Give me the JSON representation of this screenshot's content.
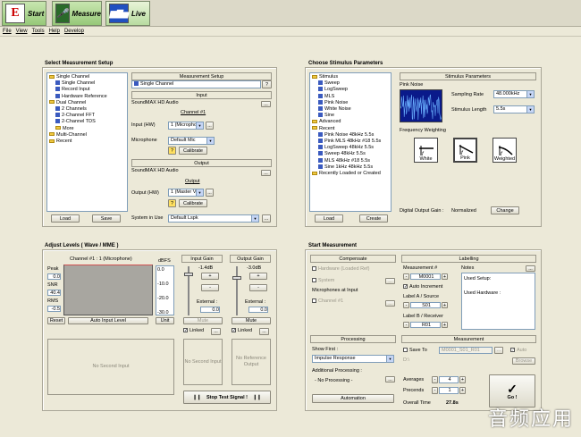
{
  "toolbar": {
    "start": "Start",
    "measure": "Measure",
    "live": "Live",
    "start_letter": "E"
  },
  "menu": [
    "File",
    "View",
    "Tools",
    "Help",
    "Develop"
  ],
  "setup": {
    "title": "Select Measurement Setup",
    "tree": [
      {
        "t": "Single Channel",
        "k": "folder",
        "i": 0
      },
      {
        "t": "Single Channel",
        "k": "item",
        "i": 1
      },
      {
        "t": "Record Input",
        "k": "item",
        "i": 1
      },
      {
        "t": "Hardware Reference",
        "k": "item",
        "i": 1
      },
      {
        "t": "Dual Channel",
        "k": "folder",
        "i": 0
      },
      {
        "t": "2 Channels",
        "k": "item",
        "i": 1
      },
      {
        "t": "2-Channel FFT",
        "k": "item",
        "i": 1
      },
      {
        "t": "2-Channel TDS",
        "k": "item",
        "i": 1
      },
      {
        "t": "More",
        "k": "folder",
        "i": 1
      },
      {
        "t": "Multi-Channel",
        "k": "folder",
        "i": 0
      },
      {
        "t": "Recent",
        "k": "folder",
        "i": 0
      }
    ],
    "load": "Load",
    "save": "Save",
    "ms_header": "Measurement Setup",
    "ms_value": "Single Channel",
    "ms_help": "?",
    "input_header": "Input",
    "input_device": "SoundMAX HD Audio",
    "channel": "Channel #1",
    "input_hw_label": "Input (HW)",
    "input_hw_value": "1 (Micropho",
    "mic_label": "Microphone",
    "mic_value": "Default Mic",
    "calibrate": "Calibrate",
    "help": "?",
    "output_header": "Output",
    "output_device": "SoundMAX HD Audio",
    "output_label": "Output",
    "output_hw_label": "Output (HW)",
    "output_hw_value": "1 (Master Vo",
    "system_label": "System in Use",
    "system_value": "Default Lspk",
    "more": "..."
  },
  "stimulus": {
    "title": "Choose Stimulus Parameters",
    "tree": [
      {
        "t": "Stimulus",
        "k": "folder",
        "i": 0
      },
      {
        "t": "Sweep",
        "k": "item",
        "i": 1
      },
      {
        "t": "LogSweep",
        "k": "item",
        "i": 1
      },
      {
        "t": "MLS",
        "k": "item",
        "i": 1
      },
      {
        "t": "Pink Noise",
        "k": "item",
        "i": 1
      },
      {
        "t": "White Noise",
        "k": "item",
        "i": 1
      },
      {
        "t": "Sine",
        "k": "item",
        "i": 1
      },
      {
        "t": "Advanced",
        "k": "folder",
        "i": 0
      },
      {
        "t": "Recent",
        "k": "folder",
        "i": 0
      },
      {
        "t": "Pink Noise 48kHz 5.5s",
        "k": "item",
        "i": 1
      },
      {
        "t": "Pink MLS 48kHz #18 5.5s",
        "k": "item",
        "i": 1
      },
      {
        "t": "LogSweep 48kHz 5.5s",
        "k": "item",
        "i": 1
      },
      {
        "t": "Sweep 48kHz 5.5s",
        "k": "item",
        "i": 1
      },
      {
        "t": "MLS 48kHz #18 5.5s",
        "k": "item",
        "i": 1
      },
      {
        "t": "Sine 1kHz 48kHz 5.5s",
        "k": "item",
        "i": 1
      },
      {
        "t": "Recently Loaded or Created",
        "k": "folder",
        "i": 0
      }
    ],
    "load": "Load",
    "create": "Create",
    "params_header": "Stimulus Parameters",
    "signal_name": "Pink Noise",
    "rate_label": "Sampling Rate",
    "rate_value": "48.000kHz",
    "length_label": "Stimulus Length",
    "length_value": "5.5s",
    "weight_label": "Frequency Weighting",
    "white": "White",
    "pink": "Pink",
    "weighted": "Weighted",
    "gain_label": "Digital Output Gain :",
    "gain_value": "Normalized",
    "change": "Change"
  },
  "levels": {
    "title": "Adjust Levels ( Wave / MME )",
    "channel_label": "Channel #1 : 1 (Microphone)",
    "dbfs": "dBFS",
    "peak": "Peak",
    "peak_val": "0.0",
    "snr": "SNR",
    "snr_val": "40.4",
    "rms": "RMS",
    "rms_val": "-0.5",
    "ticks": [
      "0.0",
      "-10.0",
      "-20.0",
      "-30.0"
    ],
    "reset": "Reset",
    "auto": "Auto Input Level",
    "unit": "Unit",
    "input_gain": "Input Gain",
    "in_db": "-1.4dB",
    "plus": "+",
    "minus": "-",
    "external": "External :",
    "in_ext": "0.0",
    "mute": "Mute",
    "linked": "Linked",
    "more": "...",
    "output_gain": "Output Gain",
    "out_db": "-3.0dB",
    "out_ext": "0.0",
    "no_second": "No Second Input",
    "no_second2": "No Second Input",
    "no_ref": "No Reference Output",
    "stop": "Stop Test Signal !",
    "stop_icon": "❙❙"
  },
  "startm": {
    "title": "Start Measurement",
    "comp_header": "Compensate",
    "hardware": "Hardware (Loaded Ref)",
    "system": "System",
    "mics": "Microphones at Input",
    "ch1": "Channel #1",
    "label_header": "Labelling",
    "meas_label": "Measurement #",
    "meas_value": "M0001",
    "auto_inc": "Auto Increment",
    "la_label": "Label A / Source",
    "la_value": "S01",
    "lb_label": "Label B / Receiver",
    "lb_value": "R01",
    "notes": "Notes",
    "notes_text1": "Used Setup:",
    "notes_text2": "Used Hardware :",
    "proc_header": "Processing",
    "show_first": "Show First :",
    "show_value": "Impulse Response",
    "addl": "Additional Processing :",
    "noproc": "- No Processing -",
    "automation": "Automation",
    "meas_header": "Measurement",
    "save_to": "Save To",
    "save_value": "M0001_S01_R01",
    "dpath": "D:\\",
    "auto": "Auto",
    "browse": "Browse",
    "averages": "Averages",
    "avg_val": "4",
    "precends": "Precends",
    "pre_val": "1",
    "overall": "Overall Time",
    "overall_val": "27.8s",
    "go": "Go !",
    "go_icon": "✓"
  },
  "watermark": "音频应用"
}
